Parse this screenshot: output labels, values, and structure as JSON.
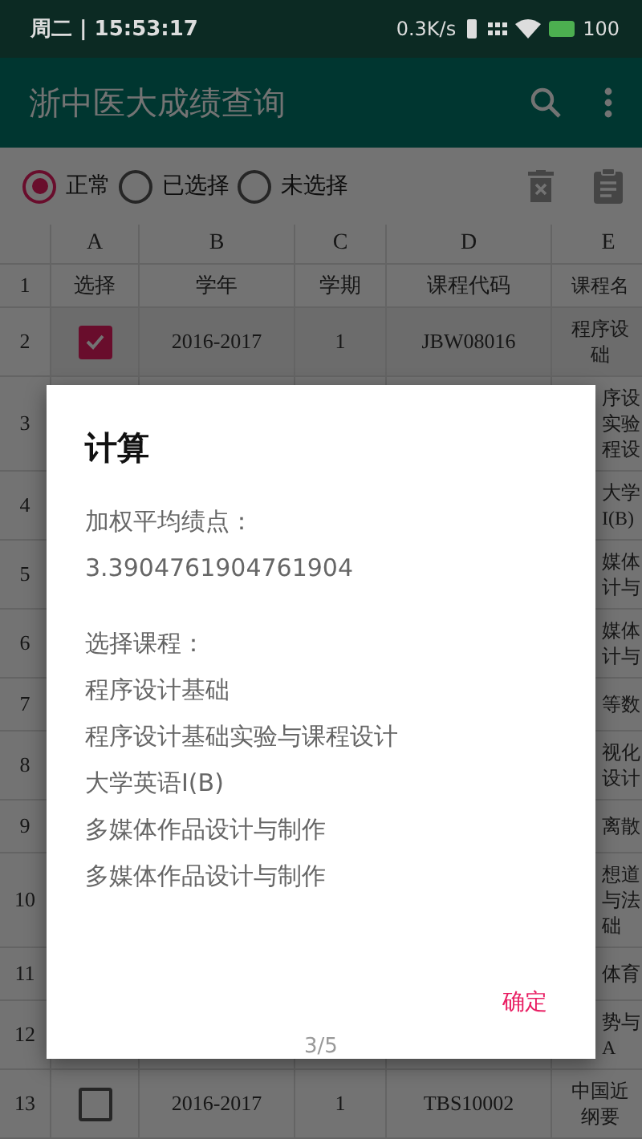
{
  "status_bar": {
    "time": "周二 | 15:53:17",
    "speed": "0.3K/s",
    "battery": "100"
  },
  "app_bar": {
    "title": "浙中医大成绩查询"
  },
  "filter": [
    {
      "label": "正常",
      "selected": true
    },
    {
      "label": "已选择",
      "selected": false
    },
    {
      "label": "未选择",
      "selected": false
    }
  ],
  "table": {
    "column_letters": [
      "A",
      "B",
      "C",
      "D",
      "E"
    ],
    "rows": [
      {
        "number": "1",
        "kind": "header",
        "cells": [
          "选择",
          "学年",
          "学期",
          "课程代码"
        ],
        "course": [
          "课程名"
        ]
      },
      {
        "number": "2",
        "kind": "full",
        "checked": true,
        "cells": [
          "2016-2017",
          "1",
          "JBW08016"
        ],
        "course": [
          "程序设",
          "础"
        ]
      },
      {
        "number": "3",
        "kind": "covered",
        "course": [
          "序设",
          "实验",
          "程设"
        ]
      },
      {
        "number": "4",
        "kind": "covered",
        "course": [
          "大学",
          "I(B)"
        ]
      },
      {
        "number": "5",
        "kind": "covered",
        "course": [
          "媒体",
          "计与"
        ]
      },
      {
        "number": "6",
        "kind": "covered",
        "course": [
          "媒体",
          "计与"
        ]
      },
      {
        "number": "7",
        "kind": "covered",
        "course": [
          "等数"
        ]
      },
      {
        "number": "8",
        "kind": "covered",
        "course": [
          "视化",
          "设计"
        ]
      },
      {
        "number": "9",
        "kind": "covered",
        "course": [
          "离散"
        ]
      },
      {
        "number": "10",
        "kind": "covered",
        "course": [
          "想道",
          "与法",
          "础"
        ]
      },
      {
        "number": "11",
        "kind": "covered",
        "course": [
          "体育"
        ]
      },
      {
        "number": "12",
        "kind": "covered",
        "course": [
          "势与",
          "A"
        ]
      },
      {
        "number": "13",
        "kind": "full",
        "checked": false,
        "cells": [
          "2016-2017",
          "1",
          "TBS10002"
        ],
        "course": [
          "中国近",
          "纲要"
        ]
      }
    ]
  },
  "dialog": {
    "title": "计算",
    "gpa_label": "加权平均绩点：",
    "gpa_value": "3.3904761904761904",
    "courses_label": "选择课程：",
    "courses": [
      "程序设计基础",
      "程序设计基础实验与课程设计",
      "大学英语I(B)",
      "多媒体作品设计与制作",
      "多媒体作品设计与制作"
    ],
    "button": "确定",
    "page": "3/5"
  }
}
